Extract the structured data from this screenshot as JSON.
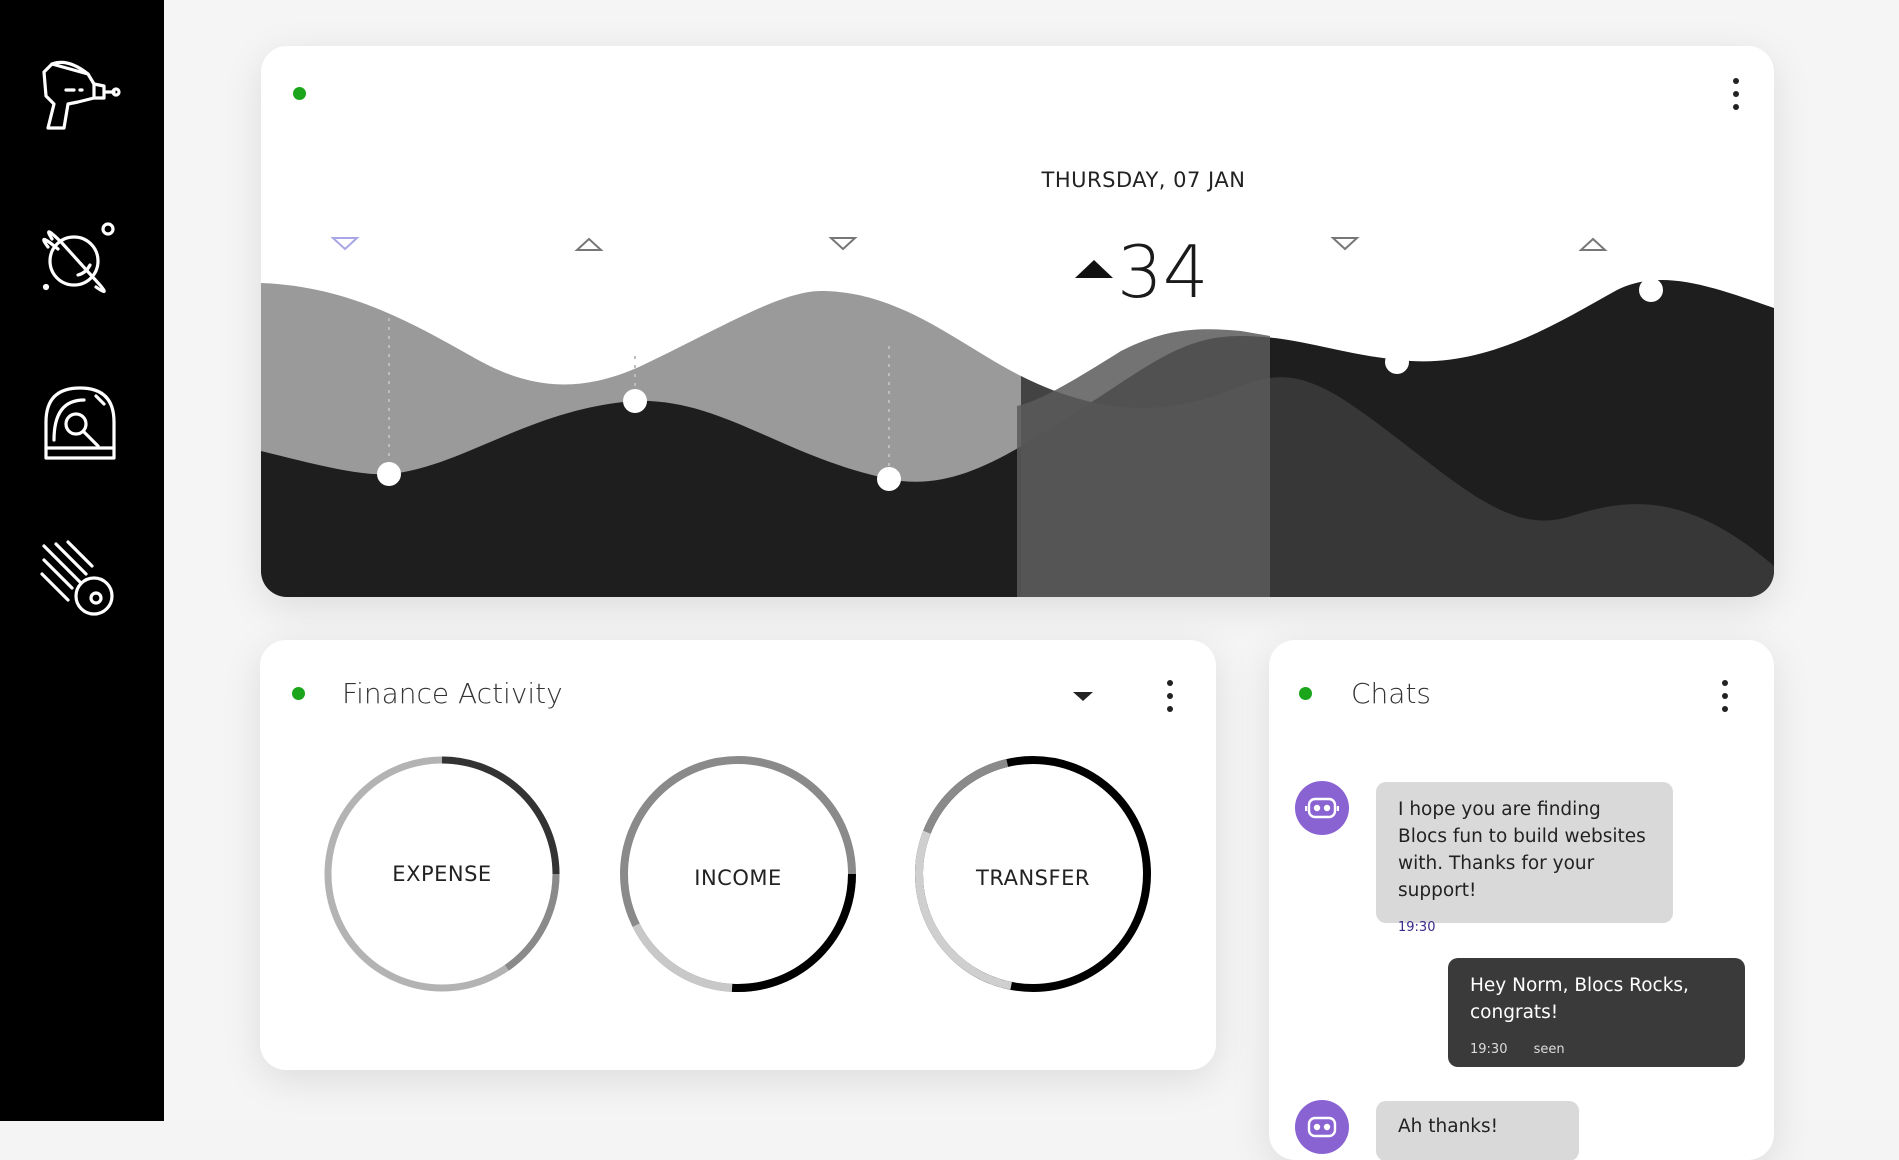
{
  "sidebar": {
    "items": [
      {
        "icon": "ray-gun-icon"
      },
      {
        "icon": "planet-icon"
      },
      {
        "icon": "radar-icon"
      },
      {
        "icon": "meteor-icon"
      }
    ]
  },
  "hero": {
    "date_label": "THURSDAY, 07 JAN",
    "value": "34",
    "trend": "up",
    "colors": {
      "front": "#1e1e1e",
      "back": "#9a9a9a",
      "highlight": "#555555"
    }
  },
  "finance": {
    "title": "Finance Activity",
    "rings": [
      {
        "label": "EXPENSE"
      },
      {
        "label": "INCOME"
      },
      {
        "label": "TRANSFER"
      }
    ]
  },
  "chats": {
    "title": "Chats",
    "messages": [
      {
        "direction": "in",
        "text": "I hope you are finding Blocs fun to build websites with. Thanks for your support!",
        "time": "19:30"
      },
      {
        "direction": "out",
        "text": "Hey Norm, Blocs Rocks, congrats!",
        "time": "19:30",
        "status": "seen"
      },
      {
        "direction": "in",
        "text": "Ah thanks!"
      }
    ]
  },
  "colors": {
    "status_dot": "#1aa51a",
    "avatar": "#8a63d2",
    "sidebar": "#000000"
  }
}
